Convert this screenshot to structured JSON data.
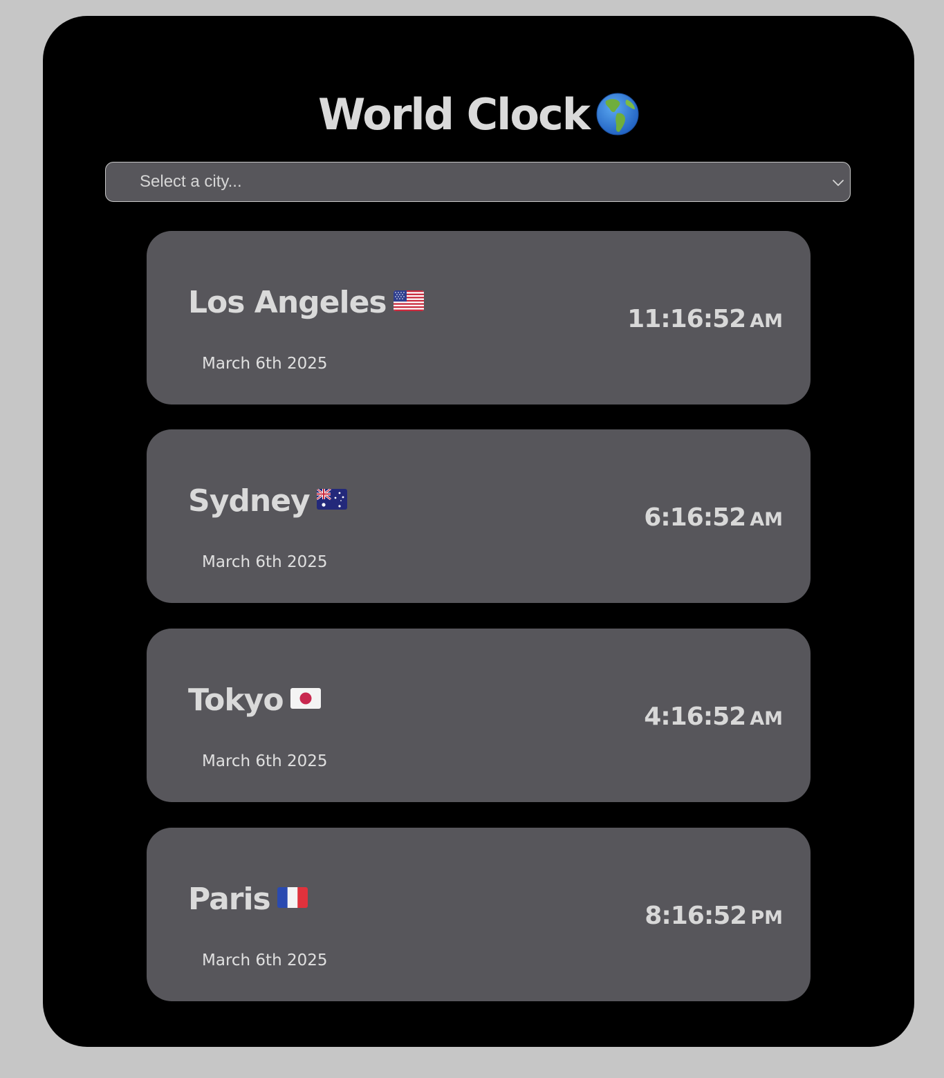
{
  "app": {
    "title": "World Clock",
    "title_icon": "globe-americas-icon"
  },
  "city_select": {
    "placeholder": "Select a city...",
    "chevron_icon": "chevron-down-icon"
  },
  "cities": [
    {
      "name": "Los Angeles",
      "flag_icon": "us-flag-icon",
      "date": "March 6th 2025",
      "time": "11:16:52",
      "ampm": "AM"
    },
    {
      "name": "Sydney",
      "flag_icon": "australia-flag-icon",
      "date": "March 6th 2025",
      "time": "6:16:52",
      "ampm": "AM"
    },
    {
      "name": "Tokyo",
      "flag_icon": "japan-flag-icon",
      "date": "March 6th 2025",
      "time": "4:16:52",
      "ampm": "AM"
    },
    {
      "name": "Paris",
      "flag_icon": "france-flag-icon",
      "date": "March 6th 2025",
      "time": "8:16:52",
      "ampm": "PM"
    }
  ],
  "colors": {
    "page_background": "#c6c6c6",
    "container_background": "#000000",
    "card_background": "#57565b",
    "text": "#dadada"
  }
}
